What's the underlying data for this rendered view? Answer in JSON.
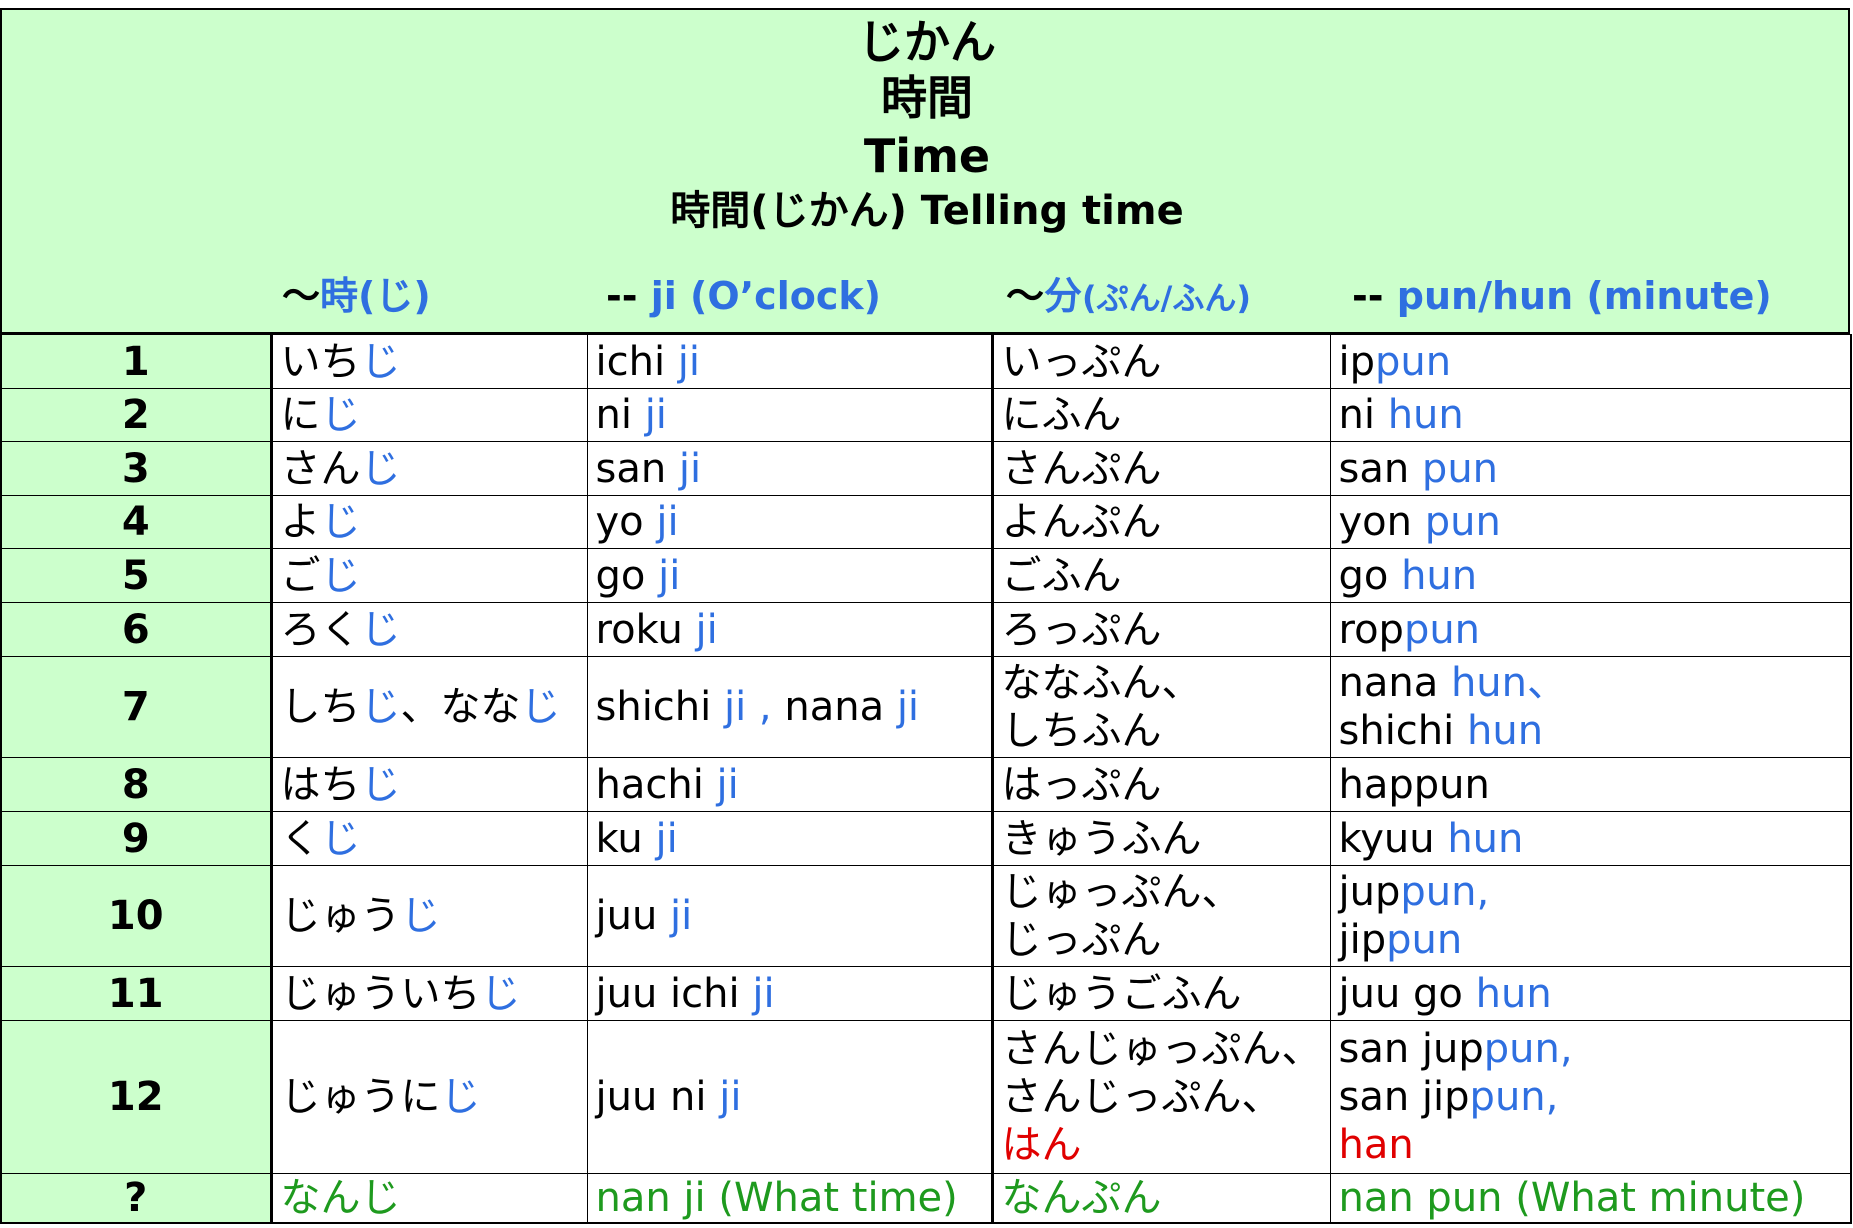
{
  "header": {
    "title_kana": "じかん",
    "title_kanji": "時間",
    "title_en": "Time",
    "subtitle": "時間(じかん) Telling time",
    "col_hour_prefix": "～",
    "col_hour_kanji": "時(じ)",
    "col_hour_en_dash": "-- ",
    "col_hour_en": "ji (O’clock)",
    "col_min_prefix": "～",
    "col_min_kanji": "分",
    "col_min_reading": "(ぷん/ふん)",
    "col_min_en_dash": "-- ",
    "col_min_en": "pun/hun (minute)"
  },
  "rows": [
    {
      "num": "1",
      "h_kana": "いち",
      "h_kana_s": "じ",
      "h_rom": "ichi ",
      "h_rom_s": "ji",
      "m_kana": [
        "いっぷん"
      ],
      "m_rom": [
        [
          "ip",
          "pun"
        ]
      ]
    },
    {
      "num": "2",
      "h_kana": "に",
      "h_kana_s": "じ",
      "h_rom": "ni ",
      "h_rom_s": "ji",
      "m_kana": [
        "にふん"
      ],
      "m_rom": [
        [
          "ni ",
          "hun"
        ]
      ]
    },
    {
      "num": "3",
      "h_kana": "さん",
      "h_kana_s": "じ",
      "h_rom": "san ",
      "h_rom_s": "ji",
      "m_kana": [
        "さんぷん"
      ],
      "m_rom": [
        [
          "san ",
          "pun"
        ]
      ]
    },
    {
      "num": "4",
      "h_kana": "よ",
      "h_kana_s": "じ",
      "h_rom": "yo ",
      "h_rom_s": "ji",
      "m_kana": [
        "よんぷん"
      ],
      "m_rom": [
        [
          "yon ",
          "pun"
        ]
      ]
    },
    {
      "num": "5",
      "h_kana": "ご",
      "h_kana_s": "じ",
      "h_rom": "go ",
      "h_rom_s": "ji",
      "m_kana": [
        "ごふん"
      ],
      "m_rom": [
        [
          "go ",
          "hun"
        ]
      ]
    },
    {
      "num": "6",
      "h_kana": "ろく",
      "h_kana_s": "じ",
      "h_rom": "roku ",
      "h_rom_s": "ji",
      "m_kana": [
        "ろっぷん"
      ],
      "m_rom": [
        [
          "rop",
          "pun"
        ]
      ]
    },
    {
      "num": "7",
      "h_kana": "しち",
      "h_kana_s": "じ",
      "h_kana2": "、なな",
      "h_kana2_s": "じ",
      "h_rom": "shichi ",
      "h_rom_s": "ji , ",
      "h_rom2": "nana ",
      "h_rom2_s": "ji",
      "m_kana": [
        "ななふん、",
        "しちふん"
      ],
      "m_rom": [
        [
          "nana ",
          "hun、"
        ],
        [
          "shichi ",
          "hun"
        ]
      ]
    },
    {
      "num": "8",
      "h_kana": "はち",
      "h_kana_s": "じ",
      "h_rom": "hachi ",
      "h_rom_s": "ji",
      "m_kana": [
        "はっぷん"
      ],
      "m_rom": [
        [
          "happun",
          ""
        ]
      ]
    },
    {
      "num": "9",
      "h_kana": "く",
      "h_kana_s": "じ",
      "h_rom": "ku ",
      "h_rom_s": "ji",
      "m_kana": [
        "きゅうふん"
      ],
      "m_rom": [
        [
          "kyuu ",
          "hun"
        ]
      ]
    },
    {
      "num": "10",
      "h_kana": "じゅう",
      "h_kana_s": "じ",
      "h_rom": "juu ",
      "h_rom_s": "ji",
      "m_kana": [
        "じゅっぷん、",
        "じっぷん"
      ],
      "m_rom": [
        [
          "jup",
          "pun,"
        ],
        [
          "jip",
          "pun"
        ]
      ]
    },
    {
      "num": "11",
      "h_kana": "じゅういち",
      "h_kana_s": "じ",
      "h_rom": "juu ichi ",
      "h_rom_s": "ji",
      "m_kana": [
        "じゅうごふん"
      ],
      "m_rom": [
        [
          "juu go ",
          "hun"
        ]
      ]
    },
    {
      "num": "12",
      "h_kana": "じゅうに",
      "h_kana_s": "じ",
      "h_rom": "juu ni ",
      "h_rom_s": "ji",
      "m_kana": [
        "さんじゅっぷん、",
        "さんじっぷん、"
      ],
      "m_kana_red": "はん",
      "m_rom": [
        [
          "san jup",
          "pun,"
        ],
        [
          "san jip",
          "pun,"
        ]
      ],
      "m_rom_red": "han"
    }
  ],
  "question_row": {
    "num": "?",
    "h_kana": "なんじ",
    "h_rom": "nan ji (What time)",
    "m_kana": "なんぷん",
    "m_rom": "nan pun (What minute)"
  },
  "colors": {
    "accent_blue": "#2f6fe0",
    "header_bg": "#ccffcc",
    "red": "#e00000",
    "green": "#1e9a1e"
  }
}
